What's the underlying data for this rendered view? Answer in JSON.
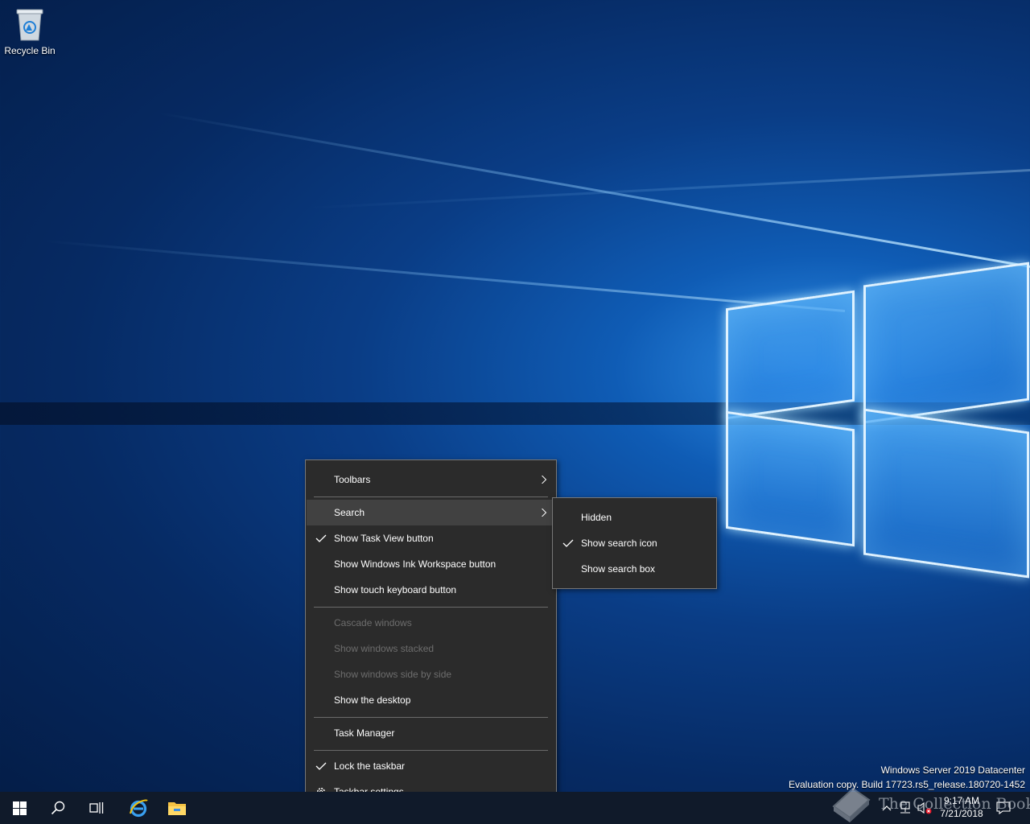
{
  "desktop": {
    "icons": [
      {
        "label": "Recycle Bin",
        "icon": "recycle-bin-icon"
      }
    ],
    "watermark": {
      "line1": "Windows Server 2019 Datacenter",
      "line2": "Evaluation copy. Build 17723.rs5_release.180720-1452"
    },
    "overlay_logo": {
      "text": "The Collection Book",
      "icon": "book-icon"
    }
  },
  "context_menu": {
    "items": [
      {
        "label": "Toolbars",
        "has_submenu": true
      },
      {
        "label": "Search",
        "has_submenu": true,
        "highlighted": true
      },
      {
        "label": "Show Task View button",
        "checked": true
      },
      {
        "label": "Show Windows Ink Workspace button"
      },
      {
        "label": "Show touch keyboard button"
      },
      {
        "label": "Cascade windows",
        "disabled": true
      },
      {
        "label": "Show windows stacked",
        "disabled": true
      },
      {
        "label": "Show windows side by side",
        "disabled": true
      },
      {
        "label": "Show the desktop"
      },
      {
        "label": "Task Manager"
      },
      {
        "label": "Lock the taskbar",
        "checked": true
      },
      {
        "label": "Taskbar settings",
        "icon": "gear-icon"
      }
    ]
  },
  "search_submenu": {
    "items": [
      {
        "label": "Hidden"
      },
      {
        "label": "Show search icon",
        "checked": true
      },
      {
        "label": "Show search box"
      }
    ]
  },
  "taskbar": {
    "buttons": [
      "start-button-windows-icon",
      "search-icon",
      "task-view-icon",
      "internet-explorer-icon",
      "file-explorer-icon"
    ],
    "tray_icons": [
      "chevron-up-icon",
      "network-icon",
      "volume-muted-icon",
      "notification-icon"
    ],
    "clock": {
      "time": "9:17 AM",
      "date": "7/21/2018"
    }
  },
  "colors": {
    "menu_bg": "#2b2b2b",
    "menu_highlight": "#414141",
    "taskbar_bg": "#101a2a",
    "disabled_text": "#6d6d6d"
  }
}
